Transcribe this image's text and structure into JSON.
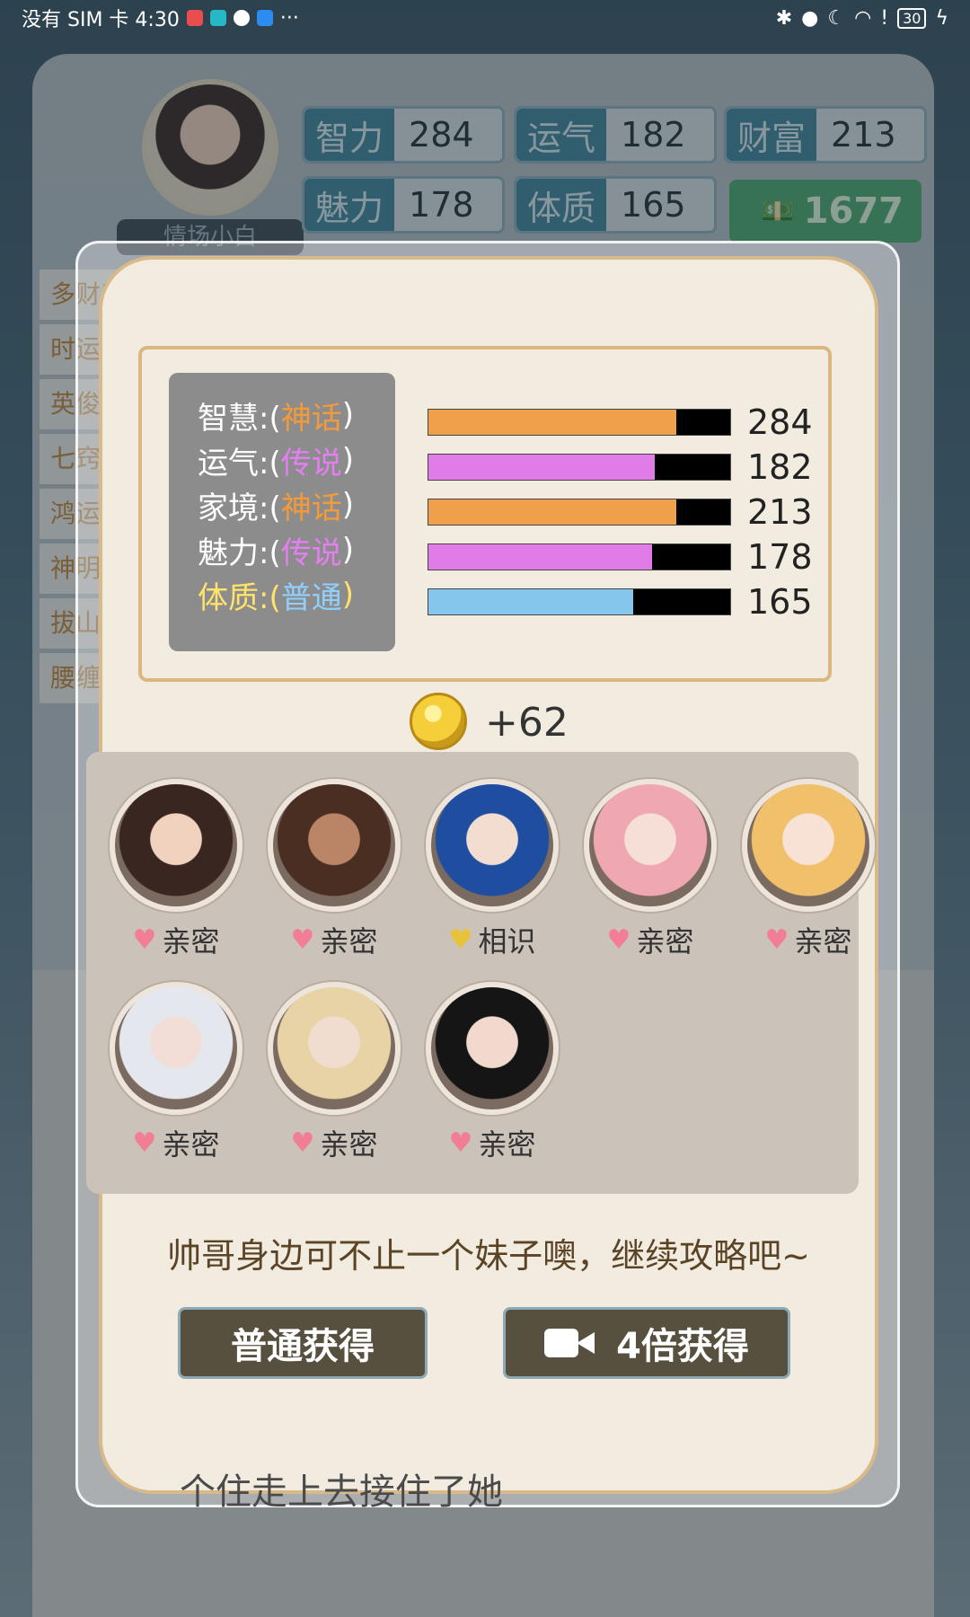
{
  "status_bar": {
    "carrier_time": "没有 SIM 卡 4:30",
    "more": "···",
    "battery": "30"
  },
  "header": {
    "nickname": "情场小白",
    "stats": [
      {
        "key": "智力",
        "value": "284"
      },
      {
        "key": "运气",
        "value": "182"
      },
      {
        "key": "财富",
        "value": "213"
      },
      {
        "key": "魅力",
        "value": "178"
      },
      {
        "key": "体质",
        "value": "165"
      }
    ],
    "money": "1677"
  },
  "side_items": [
    "多财善贾",
    "时运",
    "英俊",
    "七窍",
    "鸿运",
    "神明",
    "拔山",
    "腰缠"
  ],
  "popup": {
    "attributes": [
      {
        "name": "智慧:(",
        "grade": "神话",
        "close": ")",
        "value": 284,
        "display": "284",
        "fill": 0.82,
        "color": "#f0a04b",
        "grade_color": "#f39b3a",
        "name_color": "#ffffff"
      },
      {
        "name": "运气:(",
        "grade": "传说",
        "close": ")",
        "value": 182,
        "display": "182",
        "fill": 0.75,
        "color": "#e07be8",
        "grade_color": "#e37ff0",
        "name_color": "#ffffff"
      },
      {
        "name": "家境:(",
        "grade": "神话",
        "close": ")",
        "value": 213,
        "display": "213",
        "fill": 0.82,
        "color": "#f0a04b",
        "grade_color": "#f39b3a",
        "name_color": "#ffffff"
      },
      {
        "name": "魅力:(",
        "grade": "传说",
        "close": ")",
        "value": 178,
        "display": "178",
        "fill": 0.74,
        "color": "#e07be8",
        "grade_color": "#e37ff0",
        "name_color": "#ffffff"
      },
      {
        "name": "体质:(",
        "grade": "普通",
        "close": ")",
        "value": 165,
        "display": "165",
        "fill": 0.68,
        "color": "#85c6ec",
        "grade_color": "#8fd0ff",
        "name_color": "#ffe36a"
      }
    ],
    "reward": "+62",
    "girls": [
      {
        "relation": "亲密",
        "heart": "pink",
        "hair": "#3a2620",
        "skin": "#f0d2be"
      },
      {
        "relation": "亲密",
        "heart": "pink",
        "hair": "#4a2e22",
        "skin": "#b98566"
      },
      {
        "relation": "相识",
        "heart": "gold",
        "hair": "#1f4ea1",
        "skin": "#f3ddd0"
      },
      {
        "relation": "亲密",
        "heart": "pink",
        "hair": "#efa7b1",
        "skin": "#f5dfd6"
      },
      {
        "relation": "亲密",
        "heart": "pink",
        "hair": "#f1c06a",
        "skin": "#f8e2d6"
      },
      {
        "relation": "亲密",
        "heart": "pink",
        "hair": "#e5e7ee",
        "skin": "#f2ded6"
      },
      {
        "relation": "亲密",
        "heart": "pink",
        "hair": "#e8d3a6",
        "skin": "#f1ddd0"
      },
      {
        "relation": "亲密",
        "heart": "pink",
        "hair": "#151515",
        "skin": "#f1d9cd"
      }
    ],
    "tip": "帅哥身边可不止一个妹子噢，继续攻略吧~",
    "btn_normal": "普通获得",
    "btn_4x": "4倍获得"
  },
  "background_story": "个住走上去接住了她"
}
